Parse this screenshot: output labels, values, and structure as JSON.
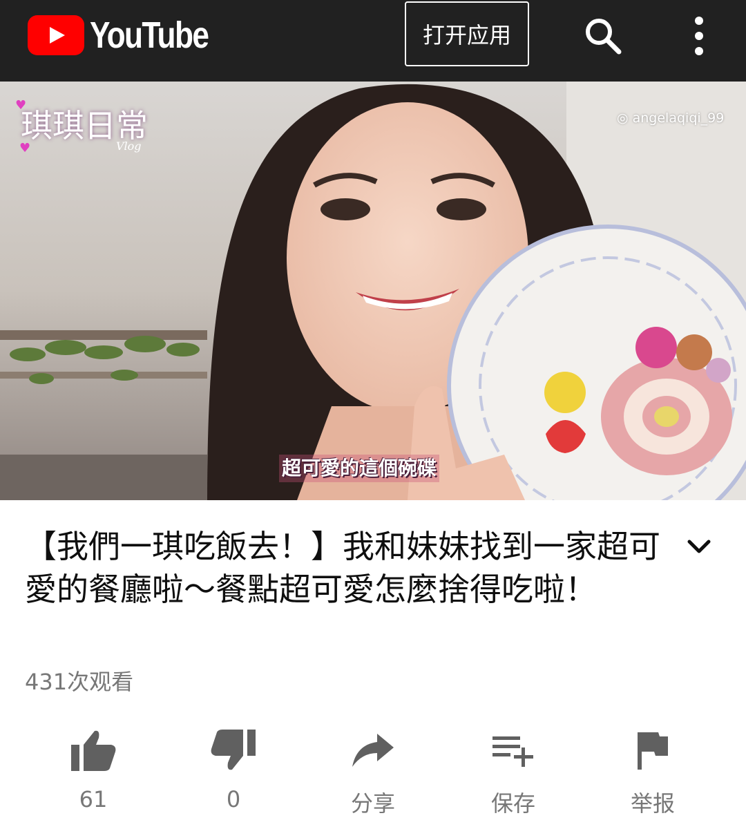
{
  "header": {
    "logo_text": "YouTube",
    "open_app_label": "打开应用",
    "search_icon": "search-icon",
    "more_icon": "more-vert-icon"
  },
  "video": {
    "brand_text": "琪琪日常",
    "brand_sub": "Vlog",
    "handle": "◎ angelaqiqi_99",
    "caption": "超可愛的這個碗碟"
  },
  "title": "【我們一琪吃飯去！】我和妹妹找到一家超可愛的餐廳啦～餐點超可愛怎麼捨得吃啦！",
  "views": "431次观看",
  "actions": {
    "like": {
      "icon": "thumb-up-icon",
      "label": "61"
    },
    "dislike": {
      "icon": "thumb-down-icon",
      "label": "0"
    },
    "share": {
      "icon": "share-icon",
      "label": "分享"
    },
    "save": {
      "icon": "playlist-add-icon",
      "label": "保存"
    },
    "report": {
      "icon": "flag-icon",
      "label": "举报"
    }
  },
  "colors": {
    "header_bg": "#212121",
    "brand_red": "#ff0000",
    "icon_gray": "#606060",
    "text_secondary": "#777777"
  }
}
